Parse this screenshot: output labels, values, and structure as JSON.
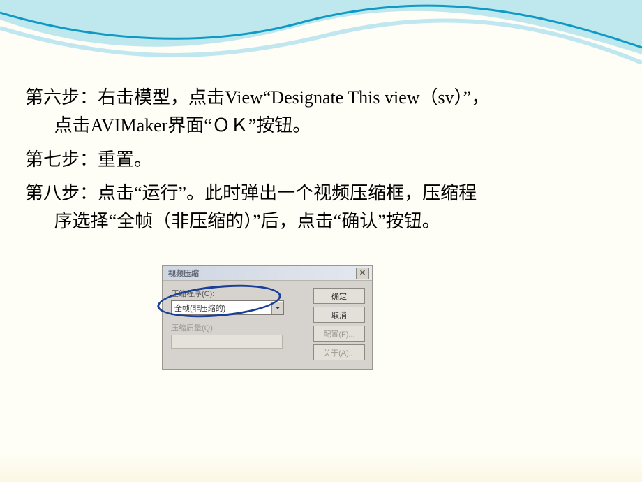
{
  "body": {
    "step6_line1": "第六步：右击模型，点击View“Designate This view（sv）”，",
    "step6_line2": "点击AVIMaker界面“ＯＫ”按钮。",
    "step7": "第七步：重置。",
    "step8_line1": "第八步：点击“运行”。此时弹出一个视频压缩框，压缩程",
    "step8_line2": "序选择“全帧（非压缩的）”后，点击“确认”按钮。"
  },
  "dialog": {
    "title": "视频压缩",
    "close_glyph": "✕",
    "compressor_label": "压缩程序(C):",
    "compressor_value": "全帧(非压缩的)",
    "quality_label": "压缩质量(Q):",
    "buttons": {
      "ok": "确定",
      "cancel": "取消",
      "config": "配置(F)...",
      "about": "关于(A)..."
    }
  }
}
